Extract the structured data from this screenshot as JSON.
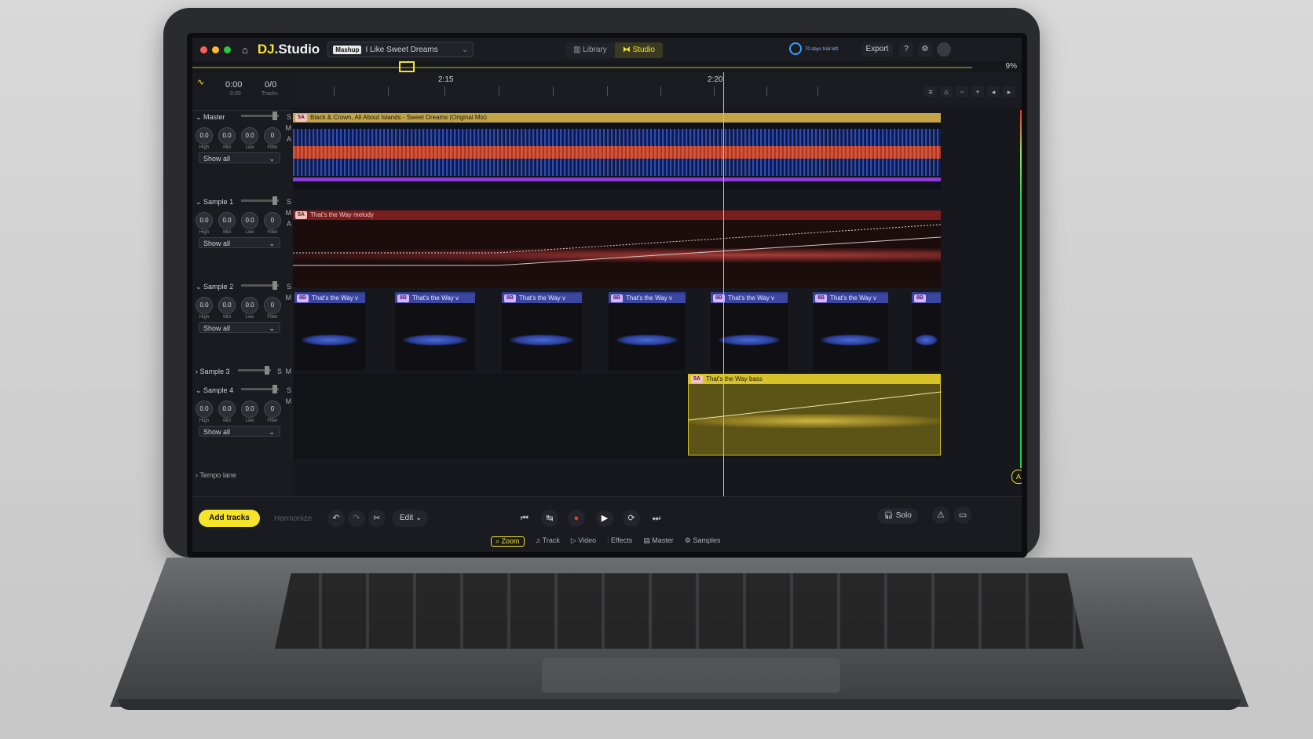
{
  "app": {
    "name_a": "DJ",
    "name_b": ".Studio",
    "project_badge": "Mashup",
    "project_name": "I Like Sweet Dreams"
  },
  "nav": {
    "library": "Library",
    "studio": "Studio"
  },
  "topright": {
    "trial": "70 days trial left",
    "export": "Export"
  },
  "overview": {
    "percent": "9%"
  },
  "timecounter": {
    "time": "0:00",
    "time_sub": "0:00",
    "tracks": "0/0",
    "tracks_label": "Tracks"
  },
  "ruler": {
    "t1": "2:15",
    "t2": "2:20"
  },
  "decks": [
    {
      "name": "Master",
      "knobs": [
        "0.0",
        "0.0",
        "0.0",
        "0"
      ],
      "labels": [
        "High",
        "Mid",
        "Low",
        "Filter"
      ],
      "show": "Show all"
    },
    {
      "name": "Sample 1",
      "knobs": [
        "0.0",
        "0.0",
        "0.0",
        "0"
      ],
      "labels": [
        "High",
        "Mid",
        "Low",
        "Filter"
      ],
      "show": "Show all"
    },
    {
      "name": "Sample 2",
      "knobs": [
        "0.0",
        "0.0",
        "0.0",
        "0"
      ],
      "labels": [
        "High",
        "Mid",
        "Low",
        "Filter"
      ],
      "show": "Show all"
    },
    {
      "name": "Sample 3"
    },
    {
      "name": "Sample 4",
      "knobs": [
        "0.0",
        "0.0",
        "0.0",
        "0"
      ],
      "labels": [
        "High",
        "Mid",
        "Low",
        "Filter"
      ],
      "show": "Show all"
    }
  ],
  "tempo_lane": "Tempo lane",
  "clips": {
    "master_tag": "5A",
    "master_title": "Black & Crown, All About Islands - Sweet Dreams (Original Mix)",
    "s1_tag": "5A",
    "s1_title": "That's the Way melody",
    "s2_tag": "8B",
    "s2_title": "That's the Way v",
    "s4_tag": "5A",
    "s4_title": "That's the Way bass"
  },
  "bottom": {
    "add_tracks": "Add tracks",
    "harmonize": "Harmonize",
    "edit": "Edit",
    "solo": "Solo"
  },
  "tabs": [
    "Zoom",
    "Track",
    "Video",
    "Effects",
    "Master",
    "Samples"
  ],
  "colors": {
    "accent": "#f5e42a",
    "master_wave": "#e4552f",
    "master_lo": "#2f57d6",
    "sample_red": "#7a1d1d",
    "sample_blue": "#3b46a0",
    "bass_yellow": "#d8c22a"
  }
}
